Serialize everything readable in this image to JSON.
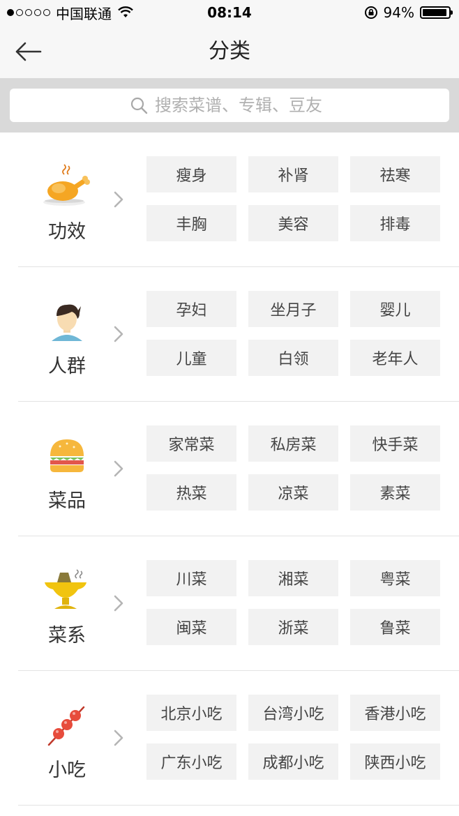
{
  "status_bar": {
    "carrier": "中国联通",
    "time": "08:14",
    "battery": "94%",
    "battery_level": 0.94,
    "signal_bars": 1,
    "signal_total": 5
  },
  "nav": {
    "title": "分类",
    "back_icon": "arrow-left-icon"
  },
  "search": {
    "placeholder": "搜索菜谱、专辑、豆友",
    "value": "",
    "icon": "search-icon"
  },
  "colors": {
    "bar_bg": "#f7f7f7",
    "search_band": "#d9d9d9",
    "tag_bg": "#f2f2f2",
    "accent_orange": "#f5a623"
  },
  "sections": [
    {
      "id": "efficacy",
      "title": "功效",
      "icon": "roast-chicken-icon",
      "tags": [
        "瘦身",
        "补肾",
        "祛寒",
        "丰胸",
        "美容",
        "排毒"
      ]
    },
    {
      "id": "people",
      "title": "人群",
      "icon": "person-icon",
      "tags": [
        "孕妇",
        "坐月子",
        "婴儿",
        "儿童",
        "白领",
        "老年人"
      ]
    },
    {
      "id": "dishes",
      "title": "菜品",
      "icon": "burger-icon",
      "tags": [
        "家常菜",
        "私房菜",
        "快手菜",
        "热菜",
        "凉菜",
        "素菜"
      ]
    },
    {
      "id": "cuisine",
      "title": "菜系",
      "icon": "hotpot-icon",
      "tags": [
        "川菜",
        "湘菜",
        "粤菜",
        "闽菜",
        "浙菜",
        "鲁菜"
      ]
    },
    {
      "id": "snacks",
      "title": "小吃",
      "icon": "skewer-icon",
      "tags": [
        "北京小吃",
        "台湾小吃",
        "香港小吃",
        "广东小吃",
        "成都小吃",
        "陕西小吃"
      ]
    }
  ]
}
